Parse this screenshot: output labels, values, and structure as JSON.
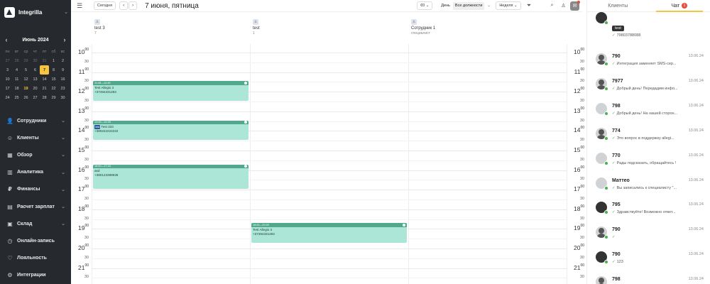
{
  "app": {
    "name": "Integrilla"
  },
  "mini_calendar": {
    "title": "Июнь 2024",
    "prev": "‹",
    "next": "›",
    "dow": [
      "пн",
      "вт",
      "ср",
      "чт",
      "пт",
      "сб",
      "вс"
    ],
    "weeks": [
      [
        "27",
        "28",
        "29",
        "30",
        "31",
        "1",
        "2"
      ],
      [
        "3",
        "4",
        "5",
        "6",
        "7",
        "8",
        "9"
      ],
      [
        "10",
        "11",
        "12",
        "13",
        "14",
        "15",
        "16"
      ],
      [
        "17",
        "18",
        "19",
        "20",
        "21",
        "22",
        "23"
      ],
      [
        "24",
        "25",
        "26",
        "27",
        "28",
        "29",
        "30"
      ]
    ],
    "selected": "7",
    "today": "19"
  },
  "nav": [
    {
      "label": "Сотрудники",
      "icon": "users-icon",
      "glyph": "👤"
    },
    {
      "label": "Клиенты",
      "icon": "clients-icon",
      "glyph": "☺"
    },
    {
      "label": "Обзор",
      "icon": "overview-icon",
      "glyph": "▦"
    },
    {
      "label": "Аналитика",
      "icon": "analytics-icon",
      "glyph": "▥"
    },
    {
      "label": "Финансы",
      "icon": "finance-icon",
      "glyph": "₽"
    },
    {
      "label": "Расчет зарплат",
      "icon": "payroll-icon",
      "glyph": "▤"
    },
    {
      "label": "Склад",
      "icon": "warehouse-icon",
      "glyph": "▣"
    },
    {
      "label": "Онлайн-запись",
      "icon": "online-booking-icon",
      "glyph": "◷"
    },
    {
      "label": "Лояльность",
      "icon": "loyalty-icon",
      "glyph": "♡"
    },
    {
      "label": "Интеграции",
      "icon": "integrations-icon",
      "glyph": "⚙"
    }
  ],
  "toolbar": {
    "today": "Сегодня",
    "title": "7 июня, пятница",
    "currency": "€0",
    "day": "День",
    "positions": "Все должности",
    "week": "Неделя"
  },
  "columns": [
    {
      "name": "test 3",
      "role": "7"
    },
    {
      "name": "test",
      "role": "1"
    },
    {
      "name": "Сотрудник 1",
      "role": "специалист"
    }
  ],
  "time_labels": [
    "10",
    "11",
    "12",
    "13",
    "14",
    "15",
    "16",
    "17",
    "18",
    "19",
    "20",
    "21"
  ],
  "half_label": "30",
  "minute_suffix": "00",
  "appointments": [
    {
      "col": 0,
      "time": "11:45—12:45",
      "name": "Test Allegio 3",
      "phone": "+37494331283",
      "tag": ""
    },
    {
      "col": 0,
      "time": "13:45—14:45",
      "name": "Test 333",
      "phone": "+380222222222",
      "tag": "new"
    },
    {
      "col": 0,
      "time": "16:00—17:15",
      "name": "asd",
      "phone": "+380123399936",
      "tag": ""
    },
    {
      "col": 1,
      "time": "19:00—20:00",
      "name": "Test Allegio 3",
      "phone": "+37494331283",
      "tag": ""
    }
  ],
  "right_panel": {
    "tabs": [
      "Клиенты",
      "Чат"
    ],
    "chat_badge": "1",
    "tooltip": "test",
    "chats": [
      {
        "name": "",
        "date": "",
        "msg": "79803788088"
      },
      {
        "name": "790",
        "date": "13.06.24",
        "msg": "Интеграция заменяет SMS-сер..."
      },
      {
        "name": "7977",
        "date": "13.06.24",
        "msg": "Добрый день! Передадим инфо..."
      },
      {
        "name": "798",
        "date": "13.06.24",
        "msg": "Добрый день! На нашей сторон..."
      },
      {
        "name": "774",
        "date": "13.06.24",
        "msg": "Это вопрос в поддержку allegi..."
      },
      {
        "name": "770",
        "date": "13.06.24",
        "msg": "Рады подсказать, обращайтесь !"
      },
      {
        "name": "Маттео",
        "date": "13.06.24",
        "msg": "Вы записались к специалисту \"..."
      },
      {
        "name": "795",
        "date": "13.06.24",
        "msg": "Здравствуйте! Возможно ответ..."
      },
      {
        "name": "790",
        "date": "13.06.24",
        "msg": ""
      },
      {
        "name": "790",
        "date": "13.06.24",
        "msg": "123"
      },
      {
        "name": "798",
        "date": "13.06.24",
        "msg": ""
      }
    ]
  }
}
